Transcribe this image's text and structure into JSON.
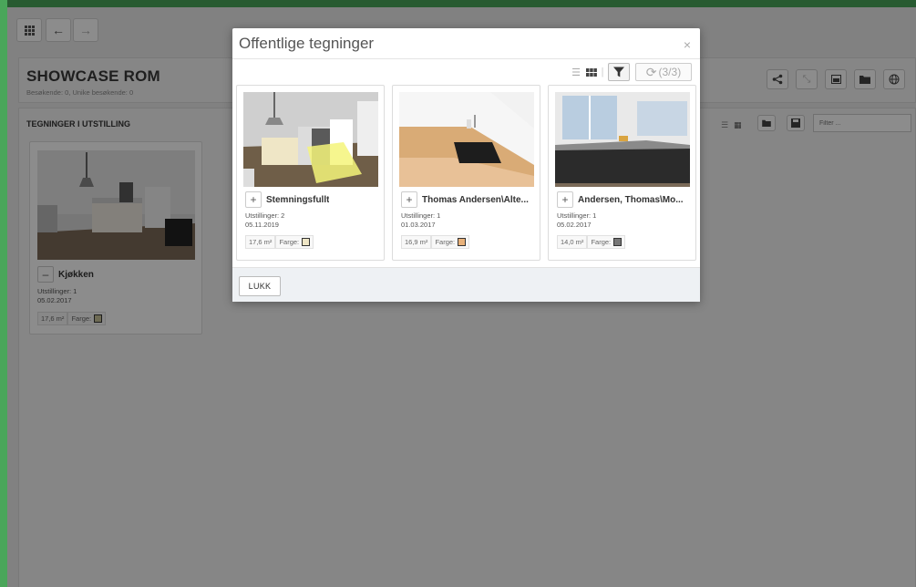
{
  "topbar": {
    "grid_icon": "grid-icon",
    "back_icon": "arrow-left-icon",
    "forward_icon": "arrow-right-icon"
  },
  "header": {
    "title": "SHOWCASE ROM",
    "subtitle": "Besøkende: 0, Unike besøkende: 0",
    "icons": [
      "share-icon",
      "expand-icon",
      "window-icon",
      "folder-icon",
      "globe-icon"
    ]
  },
  "main": {
    "section_title": "TEGNINGER I UTSTILLING",
    "filter_placeholder": "Filter ...",
    "cards": [
      {
        "name": "Kjøkken",
        "button": "–",
        "exhibitions": "Utstillinger: 1",
        "date": "05.02.2017",
        "area": "17,6 m²",
        "color_label": "Farge:",
        "color": "#c8c39a"
      }
    ]
  },
  "modal": {
    "title": "Offentlige tegninger",
    "close": "×",
    "refresh_count": "(3/3)",
    "close_button": "LUKK",
    "cards": [
      {
        "name": "Stemningsfullt",
        "button": "+",
        "exhibitions": "Utstillinger: 2",
        "date": "05.11.2019",
        "area": "17,6 m²",
        "color_label": "Farge:",
        "color": "#efe6c6"
      },
      {
        "name": "Thomas Andersen\\Alte...",
        "button": "+",
        "exhibitions": "Utstillinger: 1",
        "date": "01.03.2017",
        "area": "16,9 m²",
        "color_label": "Farge:",
        "color": "#e8b17a"
      },
      {
        "name": "Andersen, Thomas\\Mo...",
        "button": "+",
        "exhibitions": "Utstillinger: 1",
        "date": "05.02.2017",
        "area": "14,0 m²",
        "color_label": "Farge:",
        "color": "#777777"
      }
    ]
  }
}
